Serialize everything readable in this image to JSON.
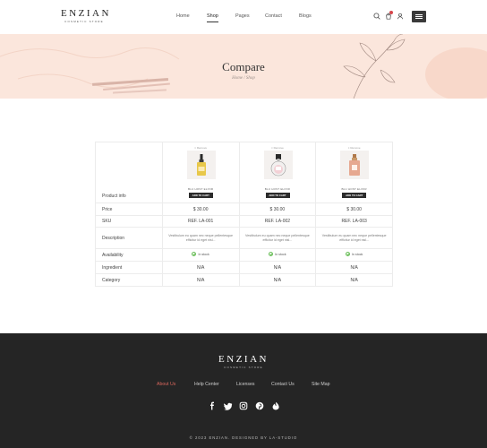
{
  "brand": {
    "name": "ENZIAN",
    "tagline": "COSMETIC STORE"
  },
  "nav": {
    "items": [
      "Home",
      "Shop",
      "Pages",
      "Contact",
      "Blogs"
    ],
    "active": "Shop"
  },
  "header_icons": [
    "search-icon",
    "cart-icon",
    "user-icon",
    "menu-icon"
  ],
  "hero": {
    "title": "Compare",
    "breadcrumb": "Home / Shop"
  },
  "compare": {
    "row_labels": {
      "product": "Product info",
      "price": "Price",
      "sku": "SKU",
      "description": "Description",
      "availability": "Availability",
      "ingredient": "Ingredient",
      "category": "Category"
    },
    "products": [
      {
        "remove": "× Remove",
        "name": "BLU HOST ELIXIR",
        "button": "ADD TO CART",
        "price": "$ 30.00",
        "sku": "REF. LA-001",
        "description": "Vestibulum eu quam nec neque pellentesque efficitur id eget nisl...",
        "availability": "In stock",
        "ingredient": "N/A",
        "category": "N/A"
      },
      {
        "remove": "× Remove",
        "name": "BLU HOST ELIXIR",
        "button": "ADD TO CART",
        "price": "$ 30.00",
        "sku": "REF. LA-002",
        "description": "Vestibulum eu quam nec neque pellentesque efficitur id eget nisl...",
        "availability": "In stock",
        "ingredient": "N/A",
        "category": "N/A"
      },
      {
        "remove": "× Remove",
        "name": "BLU HOST ELIXIR",
        "button": "ADD TO CART",
        "price": "$ 30.00",
        "sku": "REF. LA-003",
        "description": "Vestibulum eu quam nec neque pellentesque efficitur id eget nisl...",
        "availability": "In stock",
        "ingredient": "N/A",
        "category": "N/A"
      }
    ]
  },
  "footer": {
    "links": [
      "About Us",
      "Help Center",
      "Licenses",
      "Contact Us",
      "Site Map"
    ],
    "active_link": "About Us",
    "social": [
      "facebook-icon",
      "twitter-icon",
      "instagram-icon",
      "pinterest-icon",
      "dribbble-icon"
    ],
    "copyright": "© 2023 ENZIAN. DESIGNED BY LA-STUDIO"
  },
  "colors": {
    "hero_bg": "#fbe6dc",
    "footer_bg": "#252525",
    "accent": "#d8665c",
    "badge": "#d6454b"
  }
}
